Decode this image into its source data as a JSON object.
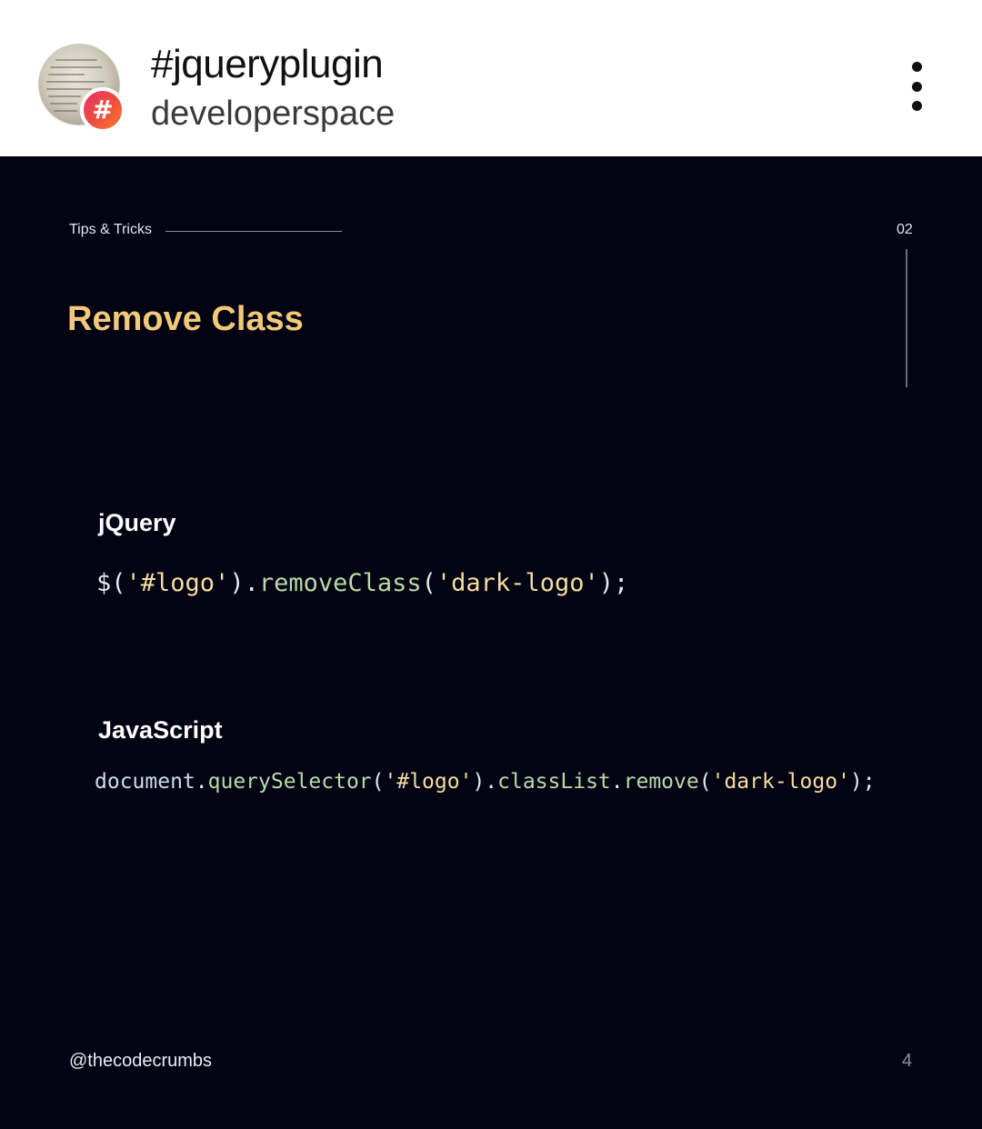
{
  "header": {
    "title": "#jqueryplugin",
    "subtitle": "developerspace",
    "badge_symbol": "#",
    "avatar_icon": "code-paper-avatar",
    "more_icon": "vertical-ellipsis-icon"
  },
  "post": {
    "category": "Tips & Tricks",
    "slide_number": "02",
    "heading": "Remove Class",
    "sections": [
      {
        "label": "jQuery",
        "code_tokens": [
          {
            "text": "$(",
            "kind": "punc"
          },
          {
            "text": "'#logo'",
            "kind": "str"
          },
          {
            "text": ").",
            "kind": "punc"
          },
          {
            "text": "removeClass",
            "kind": "fn"
          },
          {
            "text": "(",
            "kind": "punc"
          },
          {
            "text": "'dark-logo'",
            "kind": "str"
          },
          {
            "text": ");",
            "kind": "punc"
          }
        ]
      },
      {
        "label": "JavaScript",
        "code_tokens": [
          {
            "text": "document",
            "kind": "obj"
          },
          {
            "text": ".",
            "kind": "punc"
          },
          {
            "text": "querySelector",
            "kind": "fn"
          },
          {
            "text": "(",
            "kind": "punc"
          },
          {
            "text": "'#logo'",
            "kind": "str"
          },
          {
            "text": ").",
            "kind": "punc"
          },
          {
            "text": "classList",
            "kind": "fn"
          },
          {
            "text": ".",
            "kind": "punc"
          },
          {
            "text": "remove",
            "kind": "fn"
          },
          {
            "text": "(",
            "kind": "punc"
          },
          {
            "text": "'dark-logo'",
            "kind": "str"
          },
          {
            "text": ");",
            "kind": "punc"
          }
        ]
      }
    ],
    "handle": "@thecodecrumbs",
    "page_number": "4"
  },
  "colors": {
    "background": "#030313",
    "heading": "#f2c978",
    "string": "#f5dea0",
    "function": "#b8dba8",
    "badge_gradient": [
      "#e6306a",
      "#f77b32"
    ]
  }
}
